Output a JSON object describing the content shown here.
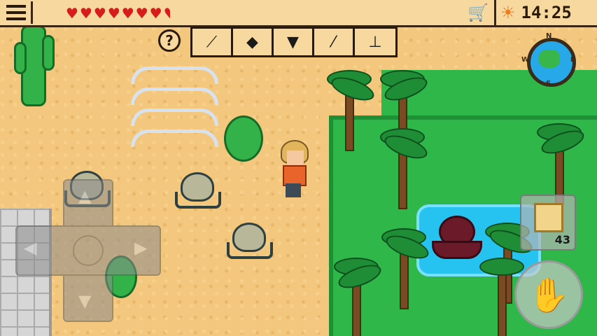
{
  "hud": {
    "menu_icon": "hamburger-menu-icon",
    "health": {
      "full_hearts": 7,
      "half_hearts": 1,
      "heart_glyph": "♥",
      "heart_color": "#d81c1c"
    },
    "shop_icon": "shopping-cart-icon",
    "time_icon": "sun-icon",
    "clock": "14:25",
    "help_label": "?",
    "tools": [
      {
        "name": "branch",
        "glyph": "⟋"
      },
      {
        "name": "fish",
        "glyph": "◆"
      },
      {
        "name": "shirt",
        "glyph": "▼"
      },
      {
        "name": "shovel",
        "glyph": "⁄"
      },
      {
        "name": "anvil",
        "glyph": "⊥"
      }
    ]
  },
  "compass": {
    "n": "N",
    "s": "S",
    "e": "E",
    "w": "W"
  },
  "inventory_slot": {
    "item": "wooden-crate",
    "count": "43"
  },
  "action_button": {
    "icon": "hand-icon",
    "glyph": "✋"
  },
  "colors": {
    "sand": "#f3c87e",
    "jungle": "#2fb74a",
    "water": "#27c3f0",
    "hud_bg": "#f7d9a0"
  }
}
